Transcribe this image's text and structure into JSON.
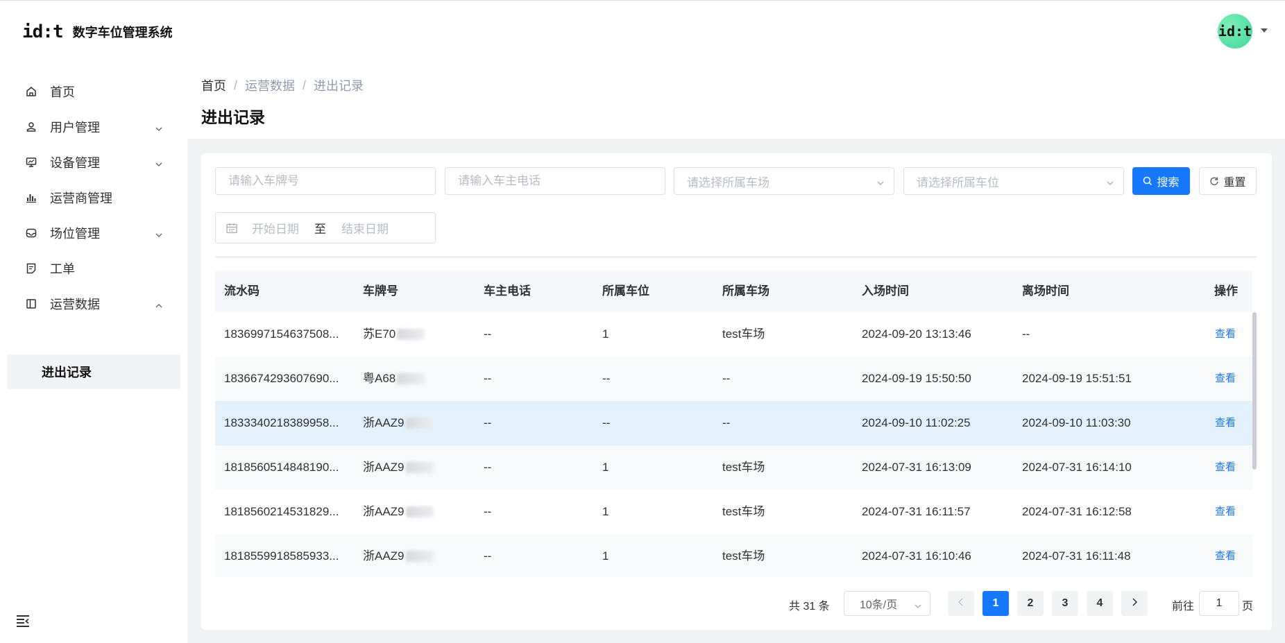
{
  "app": {
    "logo_mark": "id:t",
    "title": "数字车位管理系统",
    "avatar_text": "id:t"
  },
  "sidebar": {
    "items": [
      {
        "label": "首页",
        "icon": "home-icon"
      },
      {
        "label": "用户管理",
        "icon": "user-icon",
        "expandable": true
      },
      {
        "label": "设备管理",
        "icon": "monitor-icon",
        "expandable": true
      },
      {
        "label": "运营商管理",
        "icon": "bar-chart-icon"
      },
      {
        "label": "场位管理",
        "icon": "inbox-icon",
        "expandable": true
      },
      {
        "label": "工单",
        "icon": "document-icon"
      },
      {
        "label": "运营数据",
        "icon": "panel-icon",
        "expandable": true,
        "expanded": true
      }
    ],
    "sub_items": [
      {
        "label": "进出记录",
        "active": true
      }
    ]
  },
  "breadcrumb": [
    "首页",
    "运营数据",
    "进出记录"
  ],
  "page_title": "进出记录",
  "filters": {
    "plate_placeholder": "请输入车牌号",
    "phone_placeholder": "请输入车主电话",
    "lot_placeholder": "请选择所属车场",
    "space_placeholder": "请选择所属车位",
    "search_label": "搜索",
    "reset_label": "重置",
    "date_start_placeholder": "开始日期",
    "date_separator": "至",
    "date_end_placeholder": "结束日期"
  },
  "table": {
    "columns": [
      "流水码",
      "车牌号",
      "车主电话",
      "所属车位",
      "所属车场",
      "入场时间",
      "离场时间",
      "操作"
    ],
    "rows": [
      {
        "serial": "1836997154637508...",
        "plate": "苏E70",
        "phone": "--",
        "space": "1",
        "lot": "test车场",
        "in_time": "2024-09-20 13:13:46",
        "out_time": "--",
        "action": "查看"
      },
      {
        "serial": "1836674293607690...",
        "plate": "粤A68",
        "phone": "--",
        "space": "--",
        "lot": "--",
        "in_time": "2024-09-19 15:50:50",
        "out_time": "2024-09-19 15:51:51",
        "action": "查看"
      },
      {
        "serial": "1833340218389958...",
        "plate": "浙AAZ9",
        "phone": "--",
        "space": "--",
        "lot": "--",
        "in_time": "2024-09-10 11:02:25",
        "out_time": "2024-09-10 11:03:30",
        "action": "查看"
      },
      {
        "serial": "1818560514848190...",
        "plate": "浙AAZ9",
        "phone": "--",
        "space": "1",
        "lot": "test车场",
        "in_time": "2024-07-31 16:13:09",
        "out_time": "2024-07-31 16:14:10",
        "action": "查看"
      },
      {
        "serial": "1818560214531829...",
        "plate": "浙AAZ9",
        "phone": "--",
        "space": "1",
        "lot": "test车场",
        "in_time": "2024-07-31 16:11:57",
        "out_time": "2024-07-31 16:12:58",
        "action": "查看"
      },
      {
        "serial": "1818559918585933...",
        "plate": "浙AAZ9",
        "phone": "--",
        "space": "1",
        "lot": "test车场",
        "in_time": "2024-07-31 16:10:46",
        "out_time": "2024-07-31 16:11:48",
        "action": "查看"
      }
    ]
  },
  "pagination": {
    "total_text": "共 31 条",
    "page_size": "10条/页",
    "pages": [
      "1",
      "2",
      "3",
      "4"
    ],
    "current_page": "1",
    "goto_label": "前往",
    "goto_value": "1",
    "page_suffix": "页"
  },
  "colors": {
    "primary": "#1677ff",
    "row_highlight": "#e3f1fc",
    "avatar": "#3ed59a"
  }
}
